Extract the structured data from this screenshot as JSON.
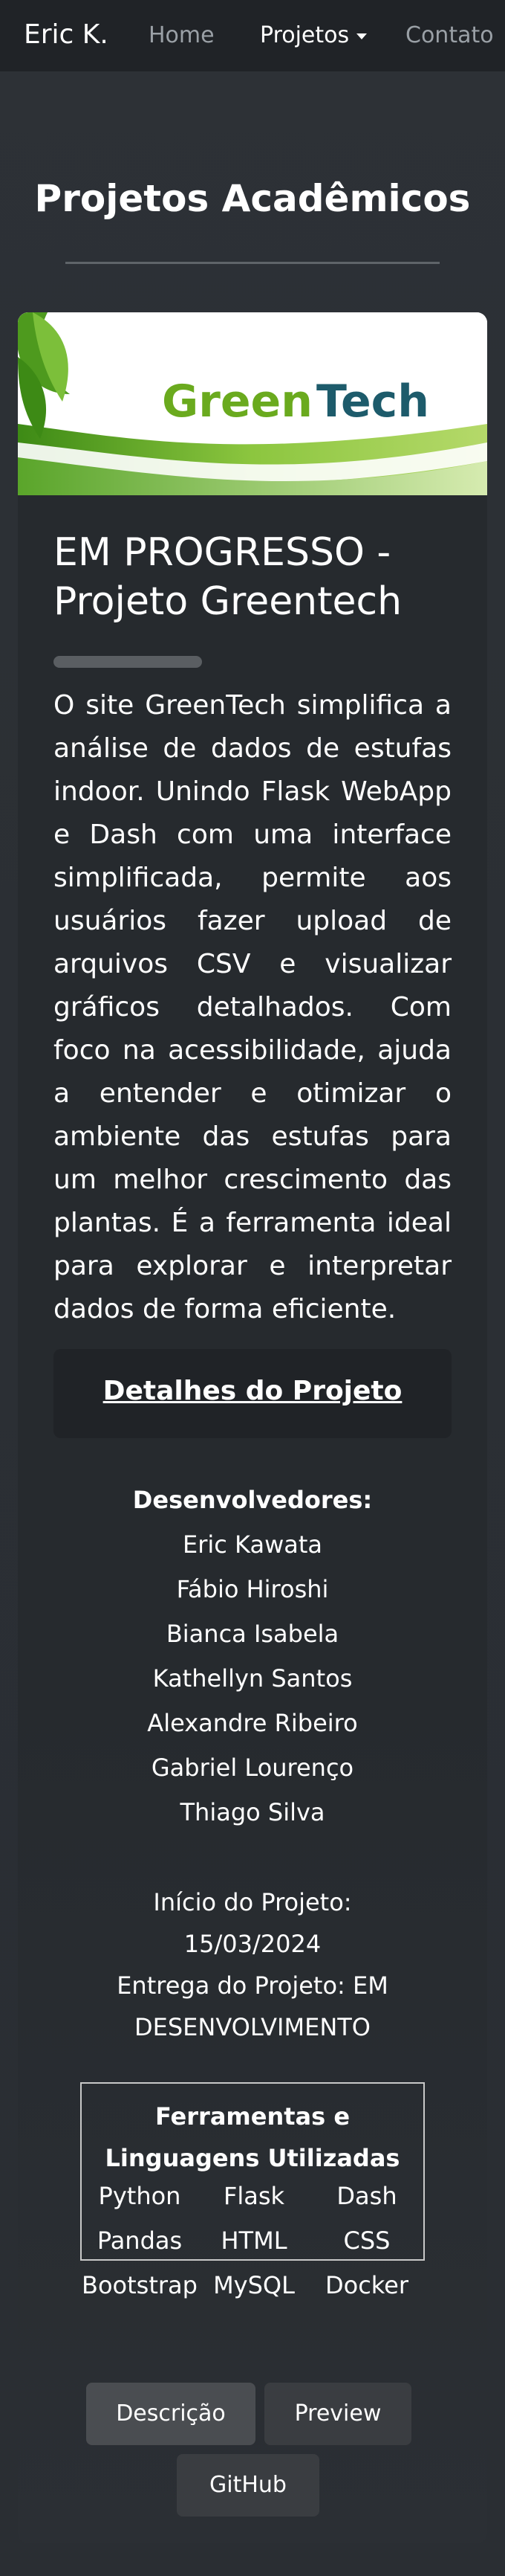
{
  "nav": {
    "brand": "Eric K.",
    "home": "Home",
    "projetos": "Projetos",
    "contato": "Contato"
  },
  "page": {
    "title": "Projetos Acadêmicos"
  },
  "banner": {
    "logo_green": "Green",
    "logo_tech": "Tech",
    "colors": {
      "green": "#6aaa1e",
      "tech": "#1d5b6b",
      "leaf": "#4e9a1e"
    }
  },
  "project": {
    "title": "EM PROGRESSO - Projeto Greentech",
    "description": "O site GreenTech simplifica a análise de dados de estufas indoor. Unindo Flask WebApp e Dash com uma interface simplificada, permite aos usuários fazer upload de arquivos CSV e visualizar gráficos detalhados. Com foco na acessibilidade, ajuda a entender e otimizar o ambiente das estufas para um melhor crescimento das plantas. É a ferramenta ideal para explorar e interpretar dados de forma eficiente.",
    "details_link": "Detalhes do Projeto",
    "developers_title": "Desenvolvedores:",
    "developers": [
      "Eric Kawata",
      "Fábio Hiroshi",
      "Bianca Isabela",
      "Kathellyn Santos",
      "Alexandre Ribeiro",
      "Gabriel Lourenço",
      "Thiago Silva"
    ],
    "start_label": "Início do Projeto:",
    "start_date": "15/03/2024",
    "delivery_line1": "Entrega do Projeto: EM",
    "delivery_line2": "DESENVOLVIMENTO",
    "tools_title_line1": "Ferramentas e",
    "tools_title_line2": "Linguagens Utilizadas",
    "tools": [
      "Python",
      "Flask",
      "Dash",
      "Pandas",
      "HTML",
      "CSS",
      "Bootstrap",
      "MySQL",
      "Docker"
    ]
  },
  "buttons": {
    "descricao": "Descrição",
    "preview": "Preview",
    "github": "GitHub"
  }
}
